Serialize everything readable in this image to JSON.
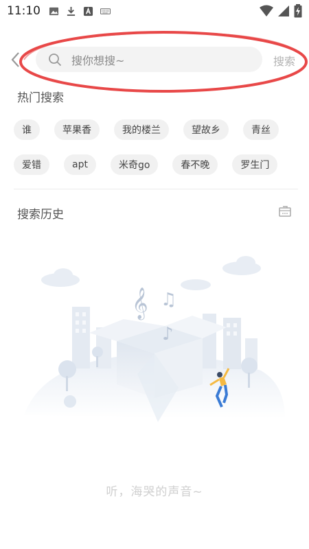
{
  "status_bar": {
    "time": "11:10",
    "left_icons": [
      "image-icon",
      "download-icon",
      "text-icon",
      "keyboard-icon"
    ],
    "right_icons": [
      "wifi-icon",
      "signal-icon",
      "battery-charging-icon"
    ]
  },
  "search": {
    "placeholder": "搜你想搜~",
    "action_label": "搜索",
    "annotation_color": "#e84848"
  },
  "hot_search": {
    "title": "热门搜索",
    "tags_row1": [
      "谁",
      "苹果香",
      "我的楼兰",
      "望故乡",
      "青丝"
    ],
    "tags_row2": [
      "爱错",
      "apt",
      "米奇go",
      "春不晚",
      "罗生门"
    ]
  },
  "history": {
    "title": "搜索历史",
    "empty_text": "听，海哭的声音~"
  },
  "colors": {
    "accent": "#e84848",
    "tag_bg": "#f1f1f1",
    "muted": "#b3b3b3"
  }
}
